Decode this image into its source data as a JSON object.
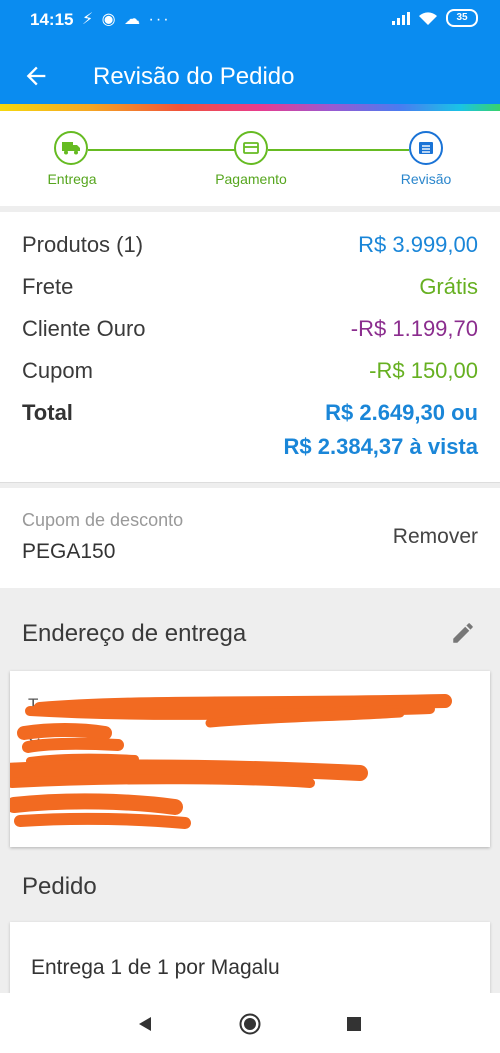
{
  "status_bar": {
    "time": "14:15",
    "notifications": "⚡ ◉ ☁ ···",
    "battery": "35"
  },
  "app_bar": {
    "title": "Revisão do Pedido",
    "back_icon": "arrow-left-icon",
    "color": "#0a8cf0"
  },
  "stepper": {
    "steps": [
      {
        "label": "Entrega",
        "icon": "truck-icon"
      },
      {
        "label": "Pagamento",
        "icon": "card-icon"
      },
      {
        "label": "Revisão",
        "icon": "list-icon"
      }
    ]
  },
  "summary": {
    "products_label": "Produtos (1)",
    "products_value": "R$ 3.999,00",
    "shipping_label": "Frete",
    "shipping_value": "Grátis",
    "gold_label": "Cliente Ouro",
    "gold_value": "-R$ 1.199,70",
    "coupon_label": "Cupom",
    "coupon_value": "-R$ 150,00",
    "total_label": "Total",
    "total_value": "R$ 2.649,30 ou",
    "total_cash": "R$ 2.384,37 à vista"
  },
  "coupon": {
    "label": "Cupom de desconto",
    "code": "PEGA150",
    "remove": "Remover"
  },
  "address": {
    "title": "Endereço de entrega",
    "edit_icon": "pencil-icon",
    "lines": [
      "T",
      "C",
      "Co",
      ""
    ]
  },
  "order": {
    "title": "Pedido",
    "shipment": "Entrega 1 de 1 por Magalu"
  },
  "nav": {
    "back_icon": "triangle-back-icon",
    "home_icon": "circle-home-icon",
    "recents_icon": "square-recents-icon"
  }
}
